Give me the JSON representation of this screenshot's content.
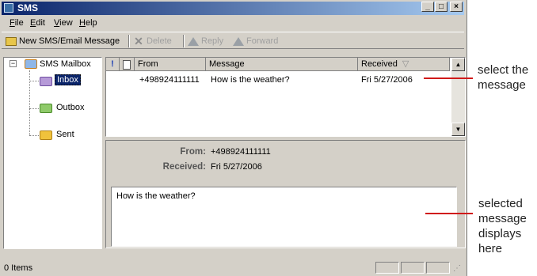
{
  "window": {
    "title": "SMS",
    "controls": [
      "_",
      "□",
      "×"
    ]
  },
  "menu": [
    "File",
    "Edit",
    "View",
    "Help"
  ],
  "toolbar": {
    "new_label": "New SMS/Email Message",
    "delete_label": "Delete",
    "reply_label": "Reply",
    "forward_label": "Forward"
  },
  "tree": {
    "root": "SMS Mailbox",
    "items": [
      {
        "label": "Inbox",
        "selected": true
      },
      {
        "label": "Outbox",
        "selected": false
      },
      {
        "label": "Sent",
        "selected": false
      }
    ]
  },
  "list": {
    "columns": [
      "",
      "",
      "From",
      "Message",
      "Received"
    ],
    "rows": [
      {
        "from": "+498924111111",
        "message": "How is the weather?",
        "received": "Fri 5/27/2006"
      }
    ]
  },
  "detail": {
    "from_label": "From:",
    "from_value": "+498924111111",
    "received_label": "Received:",
    "received_value": "Fri 5/27/2006",
    "body": "How is the weather?"
  },
  "status": {
    "text": "0 Items"
  },
  "annotations": {
    "top": [
      "select the",
      "message"
    ],
    "bottom": [
      "selected",
      "message",
      "displays",
      "here"
    ]
  },
  "colors": {
    "annotation_line": "#d01a1a",
    "title_start": "#0a246a",
    "title_end": "#a6caf0",
    "chrome": "#d4d0c8"
  }
}
